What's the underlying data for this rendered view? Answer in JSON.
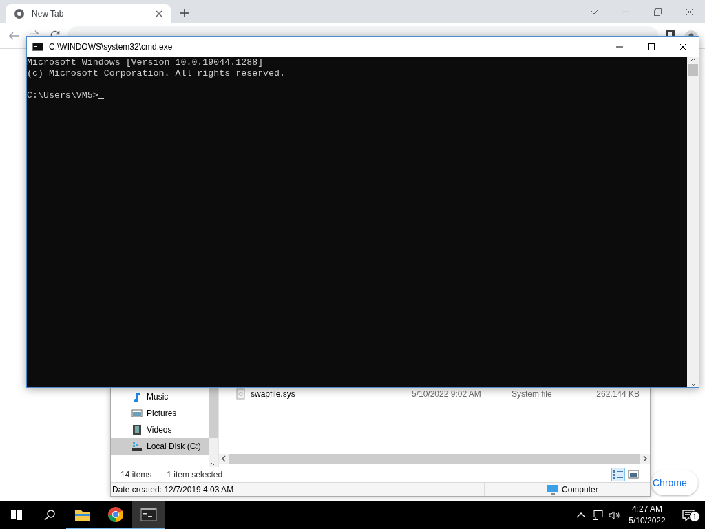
{
  "browser": {
    "tabs": [
      {
        "title": "New Tab",
        "selected": true
      }
    ],
    "customize_button": "Chrome"
  },
  "explorer": {
    "nav_items": [
      {
        "label": "Music",
        "kind": "music",
        "selected": false
      },
      {
        "label": "Pictures",
        "kind": "pictures",
        "selected": false
      },
      {
        "label": "Videos",
        "kind": "videos",
        "selected": false
      },
      {
        "label": "Local Disk (C:)",
        "kind": "disk",
        "selected": true
      }
    ],
    "files": [
      {
        "name": "swapfile.sys",
        "date": "5/10/2022 9:02 AM",
        "type": "System file",
        "size": "262,144 KB"
      }
    ],
    "item_count": "14 items",
    "selection": "1 item selected",
    "views": [
      {
        "kind": "details",
        "selected": true
      },
      {
        "kind": "thumbnails",
        "selected": false
      }
    ],
    "details_bar": {
      "date_created": "Date created: 12/7/2019 4:03 AM",
      "location": "Computer"
    }
  },
  "console": {
    "title": "C:\\WINDOWS\\system32\\cmd.exe",
    "output": [
      "Microsoft Windows [Version 10.0.19044.1288]",
      "(c) Microsoft Corporation. All rights reserved."
    ],
    "prompt": "C:\\Users\\VM5>"
  },
  "taskbar": {
    "apps": [
      {
        "kind": "explorer",
        "active": false
      },
      {
        "kind": "chrome",
        "active": false
      },
      {
        "kind": "console",
        "active": true
      }
    ],
    "clock": {
      "time": "4:27 AM",
      "date": "5/10/2022"
    },
    "notifications": "1"
  }
}
